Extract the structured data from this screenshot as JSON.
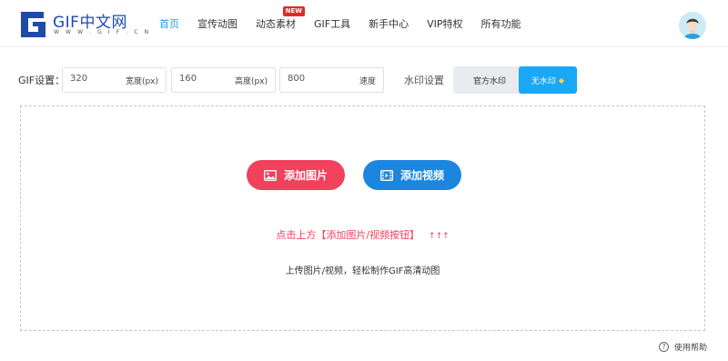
{
  "logo": {
    "text": "GIF中文网",
    "subtext": "W W W . G I F . C N"
  },
  "nav": {
    "items": [
      {
        "label": "首页"
      },
      {
        "label": "宣传动图"
      },
      {
        "label": "动态素材",
        "badge": "NEW"
      },
      {
        "label": "GIF工具"
      },
      {
        "label": "新手中心"
      },
      {
        "label": "VIP特权"
      },
      {
        "label": "所有功能"
      }
    ],
    "active_index": 0
  },
  "settings": {
    "label": "GIF设置：",
    "width": {
      "value": "320",
      "unit": "宽度(px)"
    },
    "height": {
      "value": "160",
      "unit": "高度(px)"
    },
    "speed": {
      "value": "800",
      "unit": "速度"
    },
    "watermark_label": "水印设置",
    "official_watermark": "官方水印",
    "no_watermark": "无水印"
  },
  "upload": {
    "add_image": "添加图片",
    "add_video": "添加视频",
    "hint": "点击上方【添加图片/视频按钮】",
    "hint_arrows": "↑↑↑",
    "description": "上传图片/视频，轻松制作GIF高清动图"
  },
  "help": {
    "label": "使用帮助"
  },
  "colors": {
    "accent_blue": "#1aa7f5",
    "image_button": "#f0415d",
    "video_button": "#1b86e0",
    "nav_active": "#1aa0f0",
    "badge_red": "#e02a2a"
  },
  "icons": {
    "image_button": "image-icon",
    "video_button": "video-icon",
    "no_watermark": "diamond-icon",
    "help": "question-icon"
  }
}
